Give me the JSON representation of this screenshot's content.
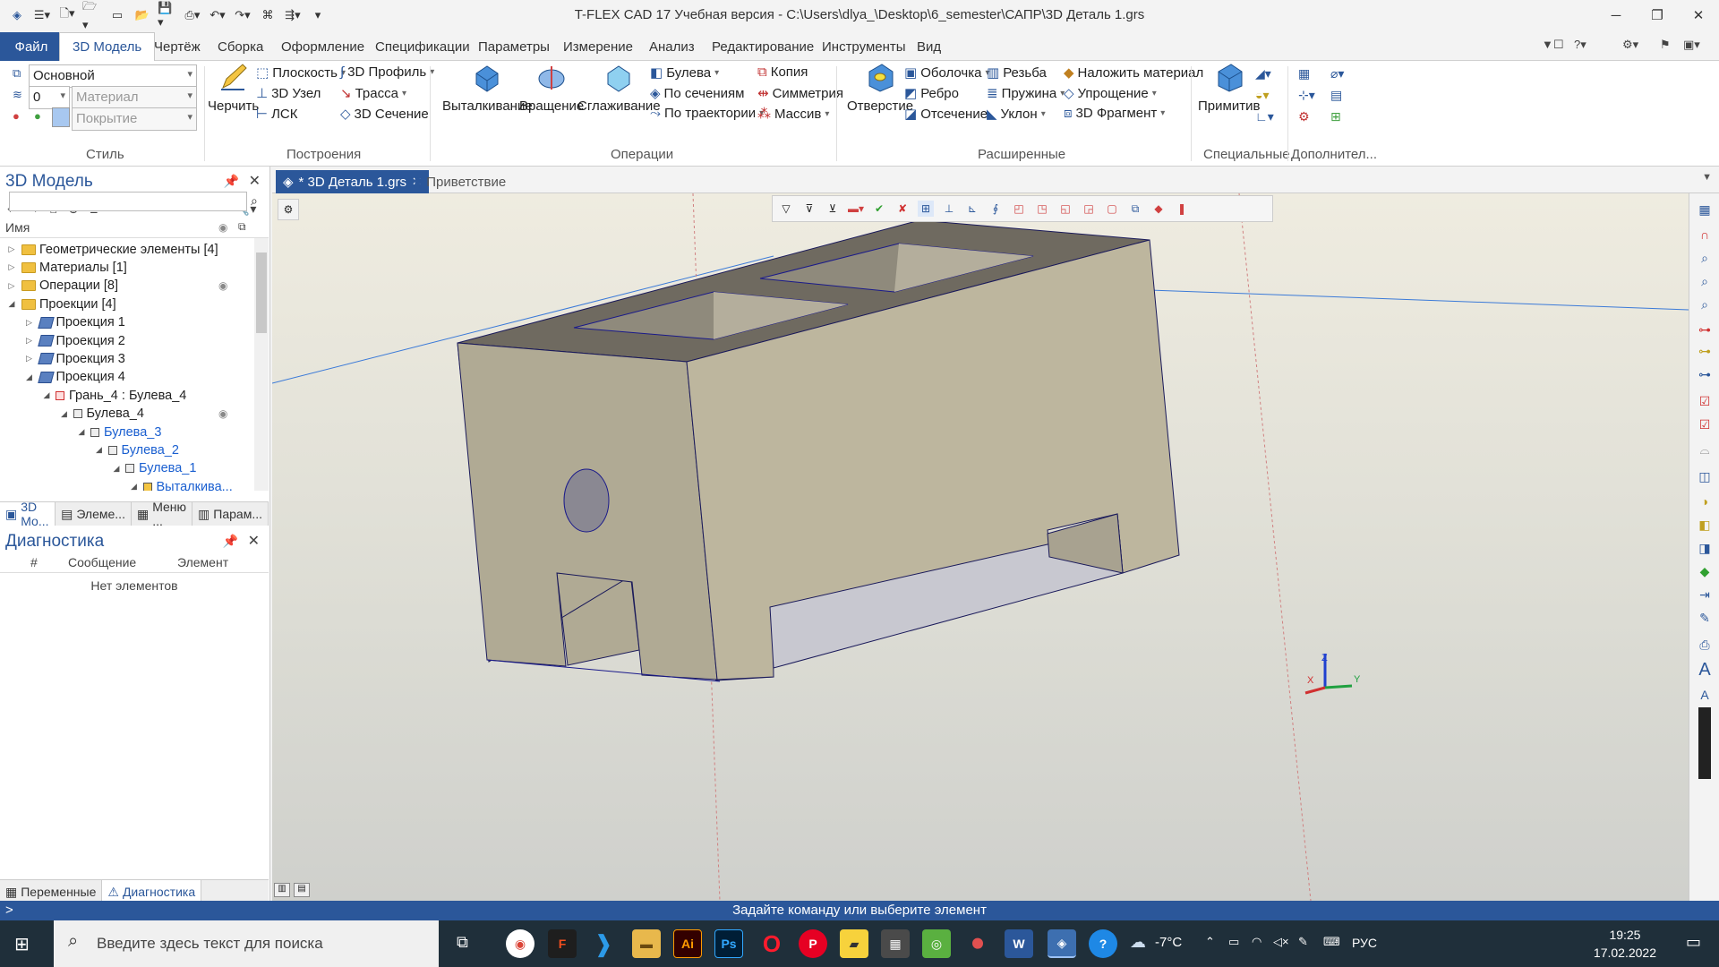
{
  "window": {
    "title": "T-FLEX CAD 17 Учебная версия - C:\\Users\\dlya_\\Desktop\\6_semester\\САПР\\3D Деталь 1.grs"
  },
  "menu": {
    "file": "Файл",
    "tabs": [
      "3D Модель",
      "Чертёж",
      "Сборка",
      "Оформление",
      "Спецификации",
      "Параметры",
      "Измерение",
      "Анализ",
      "Редактирование",
      "Инструменты",
      "Вид"
    ]
  },
  "ribbon": {
    "style": {
      "layer": "Основной",
      "thickness": "0",
      "material_placeholder": "Материал",
      "coating_placeholder": "Покрытие",
      "label": "Стиль"
    },
    "build": {
      "draw": "Черчить",
      "plane": "Плоскость",
      "node3d": "3D Узел",
      "lcs": "ЛСК",
      "profile3d": "3D Профиль",
      "path": "Трасса",
      "section3d": "3D Сечение",
      "label": "Построения"
    },
    "ops": {
      "extrude": "Выталкивание",
      "revolve": "Вращение",
      "smooth": "Сглаживание",
      "bool": "Булева",
      "sections": "По сечениям",
      "trajectory": "По траектории",
      "copy": "Копия",
      "symmetry": "Симметрия",
      "array": "Массив",
      "label": "Операции"
    },
    "ext": {
      "hole": "Отверстие",
      "shell": "Оболочка",
      "rib": "Ребро",
      "cut": "Отсечение",
      "thread": "Резьба",
      "spring": "Пружина",
      "slope": "Уклон",
      "material": "Наложить материал",
      "simplify": "Упрощение",
      "fragment3d": "3D Фрагмент",
      "label": "Расширенные"
    },
    "special": {
      "prim": "Примитив",
      "label": "Специальные"
    },
    "extra": {
      "label": "Дополнител..."
    }
  },
  "left_panel": {
    "title": "3D Модель",
    "column_name": "Имя",
    "tree": [
      {
        "label": "Геометрические элементы [4]",
        "indent": 0,
        "icon": "folder",
        "arrow": "▷",
        "blue": false
      },
      {
        "label": "Материалы [1]",
        "indent": 0,
        "icon": "folder",
        "arrow": "▷",
        "blue": false
      },
      {
        "label": "Операции [8]",
        "indent": 0,
        "icon": "folder",
        "arrow": "▷",
        "blue": false,
        "eye": true
      },
      {
        "label": "Проекции [4]",
        "indent": 0,
        "icon": "folder",
        "arrow": "◢",
        "blue": false
      },
      {
        "label": "Проекция 1",
        "indent": 1,
        "icon": "proj",
        "arrow": "▷",
        "blue": false
      },
      {
        "label": "Проекция 2",
        "indent": 1,
        "icon": "proj",
        "arrow": "▷",
        "blue": false
      },
      {
        "label": "Проекция 3",
        "indent": 1,
        "icon": "proj",
        "arrow": "▷",
        "blue": false
      },
      {
        "label": "Проекция 4",
        "indent": 1,
        "icon": "proj",
        "arrow": "◢",
        "blue": false
      },
      {
        "label": "Грань_4 : Булева_4",
        "indent": 2,
        "icon": "face",
        "arrow": "◢",
        "blue": false
      },
      {
        "label": "Булева_4",
        "indent": 3,
        "icon": "bool",
        "arrow": "◢",
        "blue": false,
        "eye": true
      },
      {
        "label": "Булева_3",
        "indent": 4,
        "icon": "bool",
        "arrow": "◢",
        "blue": true
      },
      {
        "label": "Булева_2",
        "indent": 5,
        "icon": "bool",
        "arrow": "◢",
        "blue": true
      },
      {
        "label": "Булева_1",
        "indent": 6,
        "icon": "bool",
        "arrow": "◢",
        "blue": true
      },
      {
        "label": "Выталкива...",
        "indent": 7,
        "icon": "extrude",
        "arrow": "◢",
        "blue": true
      }
    ],
    "tabs": [
      "3D Мо...",
      "Элеме...",
      "Меню ...",
      "Парам..."
    ]
  },
  "diag_panel": {
    "title": "Диагностика",
    "columns": [
      "#",
      "Сообщение",
      "Элемент"
    ],
    "empty": "Нет элементов",
    "tabs": [
      "Переменные",
      "Диагностика"
    ]
  },
  "doc_tabs": [
    "* 3D Деталь 1.grs",
    "Приветствие"
  ],
  "status": {
    "message": "Задайте команду или выберите элемент",
    "prompt": ">"
  },
  "taskbar": {
    "search": "Введите здесь текст для поиска",
    "weather": "-7°C",
    "lang": "РУС",
    "time": "19:25",
    "date": "17.02.2022"
  },
  "axes": {
    "x": "X",
    "y": "Y",
    "z": "Z"
  }
}
